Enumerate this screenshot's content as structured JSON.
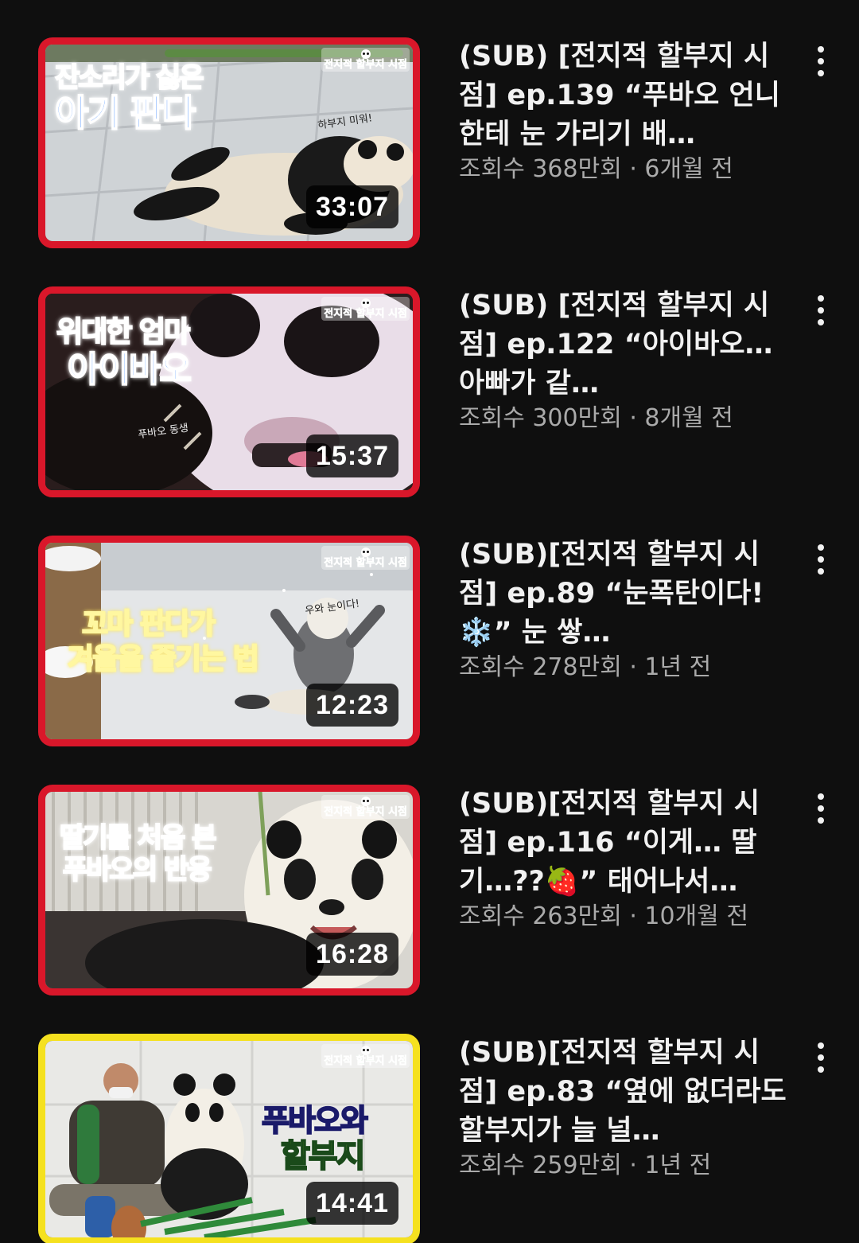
{
  "videos": [
    {
      "thumbnail_caption_line1": "잔소리가 싫은",
      "thumbnail_caption_line2": "아기 판다",
      "thumbnail_badge": "전지적 할부지 시점",
      "thumbnail_note": "하부지 미워!",
      "duration": "33:07",
      "title": "(SUB) [전지적 할부지 시점] ep.139 “푸바오 언니한테 눈 가리기 배…",
      "views": "조회수 368만회",
      "age": "6개월 전",
      "border_color": "#d9172a"
    },
    {
      "thumbnail_caption_line1": "위대한 엄마",
      "thumbnail_caption_line2": "아이바오",
      "thumbnail_badge": "전지적 할부지 시점",
      "thumbnail_note": "푸바오 동생",
      "duration": "15:37",
      "title": "(SUB) [전지적 할부지 시점] ep.122 “아이바오…아빠가 같…",
      "views": "조회수 300만회",
      "age": "8개월 전",
      "border_color": "#d9172a"
    },
    {
      "thumbnail_caption_line1": "꼬마 판다가",
      "thumbnail_caption_line2": "겨울을 즐기는 법",
      "thumbnail_badge": "전지적 할부지 시점",
      "thumbnail_note": "우와 눈이다!",
      "duration": "12:23",
      "title": "(SUB)[전지적 할부지 시점] ep.89 “눈폭탄이다!❄️” 눈 쌓…",
      "views": "조회수 278만회",
      "age": "1년 전",
      "border_color": "#d9172a"
    },
    {
      "thumbnail_caption_line1": "딸기를 처음 본",
      "thumbnail_caption_line2": "푸바오의 반응",
      "thumbnail_badge": "전지적 할부지 시점",
      "thumbnail_note": "",
      "duration": "16:28",
      "title": "(SUB)[전지적 할부지 시점] ep.116 “이게… 딸기…??🍓” 태어나서…",
      "views": "조회수 263만회",
      "age": "10개월 전",
      "border_color": "#d9172a"
    },
    {
      "thumbnail_caption_line1": "푸바오와",
      "thumbnail_caption_line2": "할부지",
      "thumbnail_badge": "전지적 할부지 시점",
      "thumbnail_note": "",
      "duration": "14:41",
      "title": "(SUB)[전지적 할부지 시점] ep.83 “옆에 없더라도 할부지가 늘 널…",
      "views": "조회수 259만회",
      "age": "1년 전",
      "border_color": "#f5e11f"
    }
  ],
  "meta_separator": " · ",
  "more_icon": "more-vert-icon",
  "colors": {
    "background": "#0f0f0f",
    "title_text": "#f1f1f1",
    "meta_text": "#aaaaaa",
    "thumbnail_border_red": "#d9172a",
    "thumbnail_border_yellow": "#f5e11f"
  }
}
